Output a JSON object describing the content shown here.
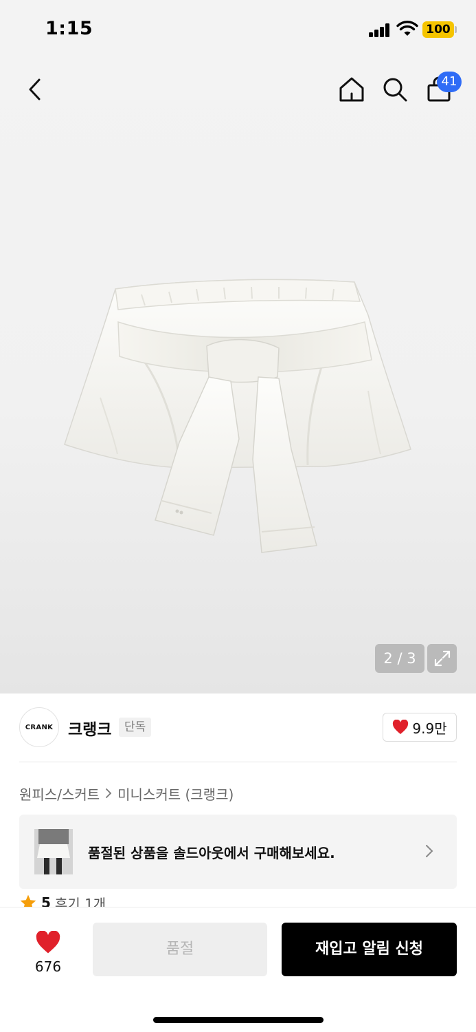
{
  "status_bar": {
    "time": "1:15",
    "battery": "100",
    "icons": [
      "signal-icon",
      "wifi-icon",
      "battery-icon"
    ]
  },
  "header": {
    "icons": [
      "back-arrow-icon",
      "home-icon",
      "search-icon",
      "shopping-bag-icon"
    ],
    "cart_count": "41"
  },
  "gallery": {
    "counter": "2 / 3",
    "expand_icon": "expand-icon"
  },
  "brand": {
    "logo_text": "CRANK",
    "name": "크랭크",
    "tag": "단독",
    "likes": "9.9만"
  },
  "breadcrumb": {
    "category": "원피스/스커트",
    "subcategory": "미니스커트 (크랭크)"
  },
  "soldout_banner": {
    "text": "품절된 상품을 솔드아웃에서 구매해보세요."
  },
  "rating": {
    "score": "5",
    "reviews": "후기 1개"
  },
  "actions": {
    "wish_count": "676",
    "soldout_label": "품절",
    "restock_label": "재입고 알림 신청"
  },
  "colors": {
    "accent_blue": "#2f6cf6",
    "heart_red": "#e0212b",
    "battery_yellow": "#f5c400",
    "star_orange": "#f59e0b",
    "primary_black": "#000000"
  }
}
